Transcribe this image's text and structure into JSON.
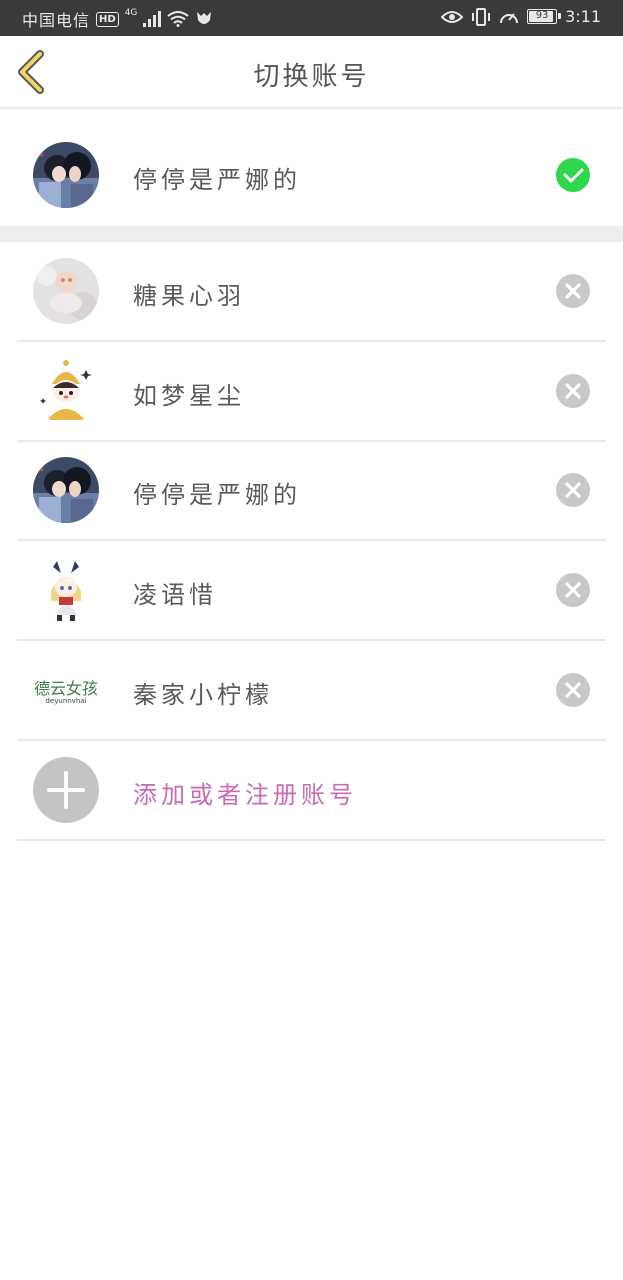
{
  "status_bar": {
    "carrier": "中国电信",
    "hd": "HD",
    "network": "4G",
    "battery": "93",
    "time": "3:11"
  },
  "header": {
    "title": "切换账号"
  },
  "current_account": {
    "name": "停停是严娜的",
    "avatar": "anime-couple-avatar",
    "status_icon": "check-icon",
    "accent": "#2dd84a"
  },
  "accounts": [
    {
      "name": "糖果心羽",
      "avatar": "plush-toy-avatar"
    },
    {
      "name": "如梦星尘",
      "avatar": "cartoon-girl-avatar"
    },
    {
      "name": "停停是严娜的",
      "avatar": "anime-couple-avatar"
    },
    {
      "name": "凌语惜",
      "avatar": "chibi-girl-avatar"
    },
    {
      "name": "秦家小柠檬",
      "avatar": "text-logo-avatar",
      "avatar_text": "德云女孩",
      "avatar_subtext": "deyunnvhai"
    }
  ],
  "add_account": {
    "label": "添加或者注册账号",
    "color": "#c76bb5"
  }
}
